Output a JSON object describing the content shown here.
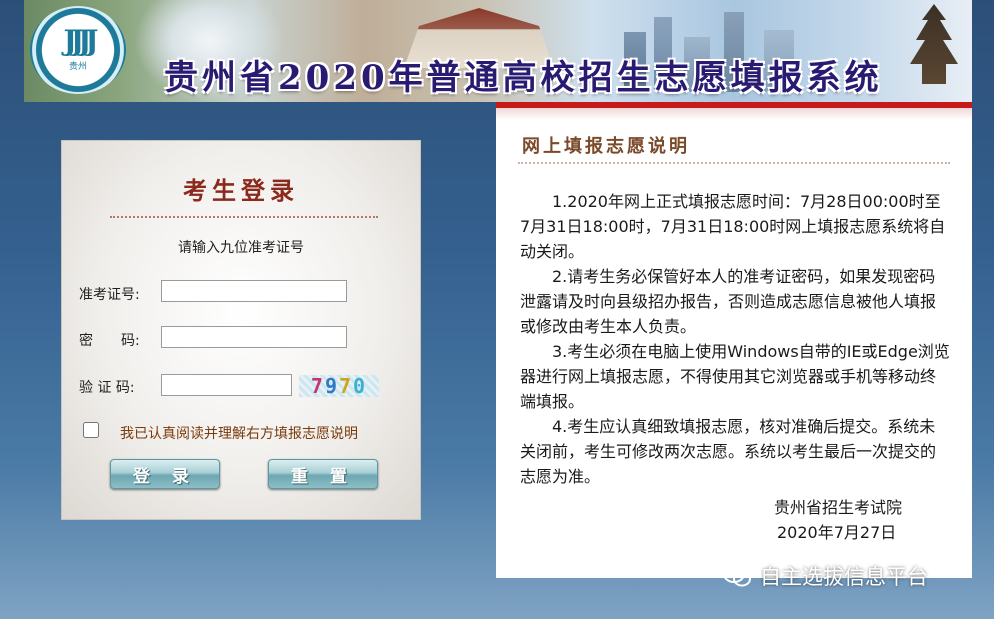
{
  "banner": {
    "title": "贵州省2020年普通高校招生志愿填报系统",
    "logo_caption": "贵州"
  },
  "login": {
    "title": "考生登录",
    "hint": "请输入九位准考证号",
    "exam_no_label": "准考证号:",
    "password_label": "密　　码:",
    "captcha_label": "验 证 码:",
    "exam_no_value": "",
    "password_value": "",
    "captcha_value": "",
    "captcha_digits": [
      "7",
      "9",
      "7",
      "0"
    ],
    "agree_checked": false,
    "agree_label": "我已认真阅读并理解右方填报志愿说明",
    "login_button": "登 录",
    "reset_button": "重 置"
  },
  "notice": {
    "title": "网上填报志愿说明",
    "paragraphs": [
      "1.2020年网上正式填报志愿时间：7月28日00:00时至7月31日18:00时，7月31日18:00时网上填报志愿系统将自动关闭。",
      "2.请考生务必保管好本人的准考证密码，如果发现密码泄露请及时向县级招办报告，否则造成志愿信息被他人填报或修改由考生本人负责。",
      "3.考生必须在电脑上使用Windows自带的IE或Edge浏览器进行网上填报志愿，不得使用其它浏览器或手机等移动终端填报。",
      "4.考生应认真细致填报志愿，核对准确后提交。系统未关闭前，考生可修改两次志愿。系统以考生最后一次提交的志愿为准。"
    ],
    "signature": "贵州省招生考试院",
    "date": "2020年7月27日"
  },
  "watermark": {
    "text": "自主选拔信息平台",
    "icon": "wechat-icon"
  },
  "colors": {
    "accent_red": "#c61a1a",
    "login_title": "#8b2a1c",
    "agree_text": "#7a3a0a",
    "banner_title": "#2a1b72"
  }
}
